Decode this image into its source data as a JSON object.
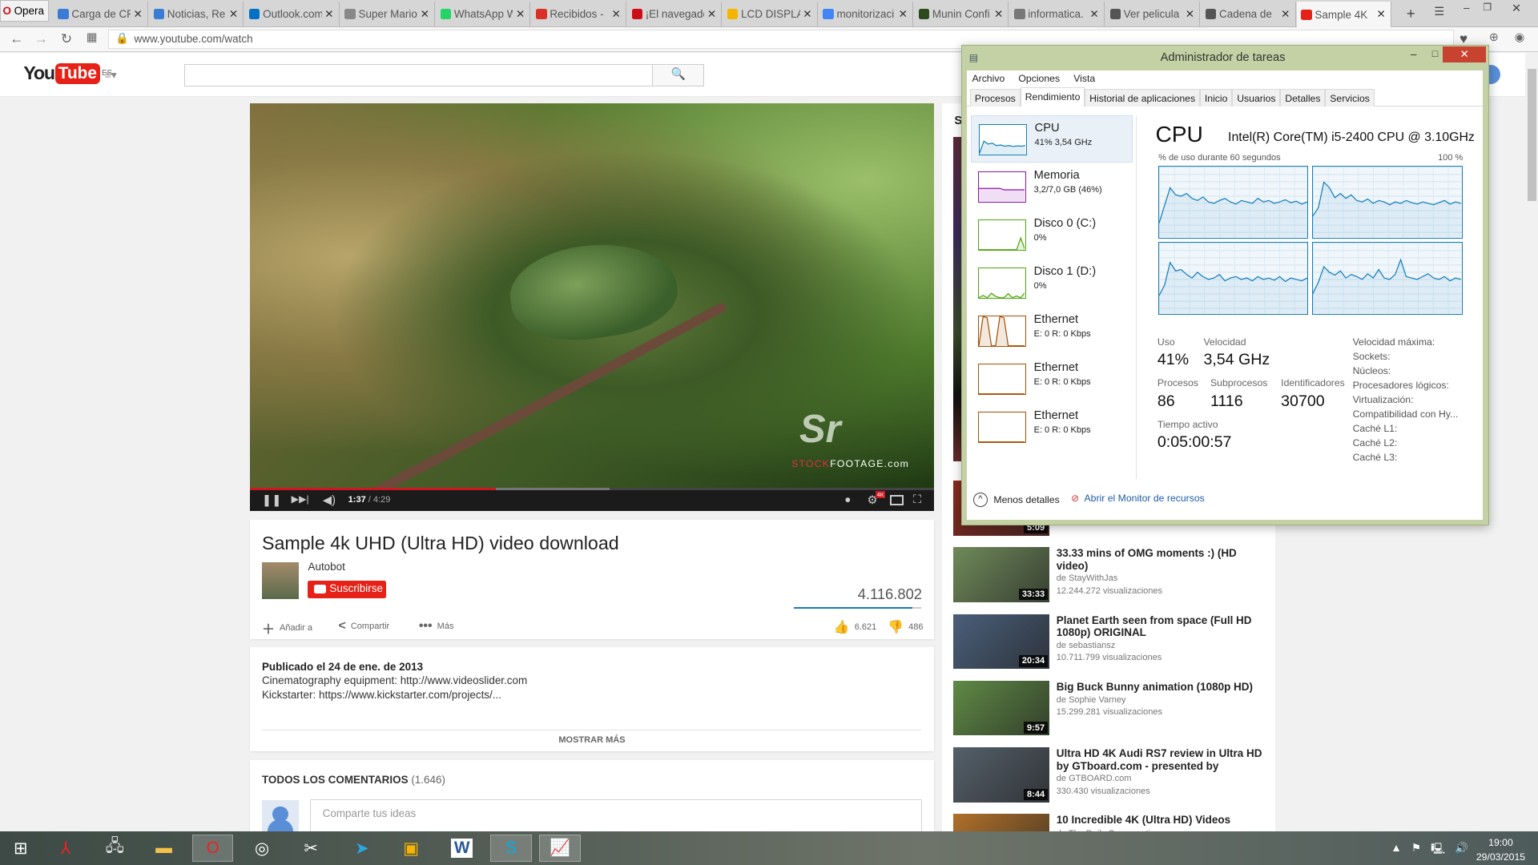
{
  "browser": {
    "name": "Opera",
    "tabs": [
      {
        "title": "Carga de CP",
        "color": "#3a7bd5"
      },
      {
        "title": "Noticias, Re",
        "color": "#3a7bd5"
      },
      {
        "title": "Outlook.com",
        "color": "#0072c6"
      },
      {
        "title": "Super Mario",
        "color": "#888888"
      },
      {
        "title": "WhatsApp W",
        "color": "#25d366"
      },
      {
        "title": "Recibidos -",
        "color": "#d93025"
      },
      {
        "title": "¡El navegado",
        "color": "#cc0f16"
      },
      {
        "title": "LCD DISPLA",
        "color": "#f4b400"
      },
      {
        "title": "monitorizaci",
        "color": "#4285f4"
      },
      {
        "title": "Munin Confi",
        "color": "#2d4a1e"
      },
      {
        "title": "informatica.",
        "color": "#777777"
      },
      {
        "title": "Ver pelicula",
        "color": "#555555"
      },
      {
        "title": "Cadena de",
        "color": "#555555"
      },
      {
        "title": "Sample 4K",
        "color": "#e62117"
      }
    ],
    "url": "www.youtube.com/watch"
  },
  "youtube": {
    "logo_you": "You",
    "logo_tube": "Tube",
    "region": "ES",
    "search_placeholder": "",
    "player": {
      "current": "1:37",
      "total": "/ 4:29",
      "played_fraction": 0.36,
      "buffered_fraction": 0.526,
      "quality_badge": "4K",
      "watermark": "Sr",
      "watermark_sub_red": "STOCK",
      "watermark_sub": "FOOTAGE.com"
    },
    "video": {
      "title": "Sample 4k UHD (Ultra HD) video download",
      "channel": "Autobot",
      "subscribe": "Suscribirse",
      "views": "4.116.802",
      "likes": "6.621",
      "dislikes": "486",
      "like_fraction": 0.93,
      "actions": {
        "add": "Añadir a",
        "share": "Compartir",
        "more": "Más"
      }
    },
    "description": {
      "published": "Publicado el 24 de ene. de 2013",
      "lines": [
        {
          "label": "Cinematography equipment: ",
          "link": "http://www.videoslider.com"
        },
        {
          "label": "Kickstarter: ",
          "link": "https://www.kickstarter.com/projects/..."
        }
      ],
      "show_more": "MOSTRAR MÁS"
    },
    "comments": {
      "heading": "TODOS LOS COMENTARIOS",
      "count": "(1.646)",
      "placeholder": "Comparte tus ideas"
    },
    "sidebar_heading_letter": "S",
    "related": [
      {
        "title": "",
        "channel": "",
        "views": "",
        "duration": "5:09",
        "thumb": "#8a2a20"
      },
      {
        "title": "33.33 mins of OMG moments :) (HD video)",
        "channel": "de StayWithJas",
        "views": "12.244.272 visualizaciones",
        "duration": "33:33",
        "thumb": "#6f8a5a"
      },
      {
        "title": "Planet Earth seen from space (Full HD 1080p) ORIGINAL",
        "channel": "de sebastiansz",
        "views": "10.711.799 visualizaciones",
        "duration": "20:34",
        "thumb": "#4a5f7a"
      },
      {
        "title": "Big Buck Bunny animation (1080p HD)",
        "channel": "de Sophie Varney",
        "views": "15.299.281 visualizaciones",
        "duration": "9:57",
        "thumb": "#5f8a45"
      },
      {
        "title": "Ultra HD 4K Audi RS7 review in Ultra HD by GTboard.com - presented by",
        "channel": "de GTBOARD.com",
        "views": "330.430 visualizaciones",
        "duration": "8:44",
        "thumb": "#55606a"
      },
      {
        "title": "10 Incredible 4K (Ultra HD) Videos",
        "channel": "de The Daily Conversation",
        "views": "",
        "duration": "",
        "thumb": "#b0702a"
      }
    ]
  },
  "task_manager": {
    "title": "Administrador de tareas",
    "menu": [
      "Archivo",
      "Opciones",
      "Vista"
    ],
    "tabs": [
      "Procesos",
      "Rendimiento",
      "Historial de aplicaciones",
      "Inicio",
      "Usuarios",
      "Detalles",
      "Servicios"
    ],
    "active_tab": "Rendimiento",
    "resources": [
      {
        "name": "CPU",
        "sub": "41% 3,54 GHz",
        "color": "#117dbb"
      },
      {
        "name": "Memoria",
        "sub": "3,2/7,0 GB (46%)",
        "color": "#8b12ae"
      },
      {
        "name": "Disco 0 (C:)",
        "sub": "0%",
        "color": "#4da60c"
      },
      {
        "name": "Disco 1 (D:)",
        "sub": "0%",
        "color": "#4da60c"
      },
      {
        "name": "Ethernet",
        "sub": "E: 0 R: 0 Kbps",
        "color": "#a74f01"
      },
      {
        "name": "Ethernet",
        "sub": "E: 0 R: 0 Kbps",
        "color": "#a74f01"
      },
      {
        "name": "Ethernet",
        "sub": "E: 0 R: 0 Kbps",
        "color": "#a74f01"
      }
    ],
    "cpu": {
      "heading": "CPU",
      "model": "Intel(R) Core(TM) i5-2400 CPU @ 3.10GHz",
      "graph_label": "% de uso durante 60 segundos",
      "graph_max": "100 %",
      "core_history": [
        [
          20,
          45,
          70,
          60,
          58,
          62,
          55,
          52,
          57,
          50,
          48,
          52,
          55,
          50,
          47,
          52,
          50,
          48,
          55,
          50,
          52,
          48,
          50,
          53,
          49,
          51,
          47,
          50
        ],
        [
          30,
          42,
          78,
          70,
          56,
          62,
          55,
          60,
          52,
          50,
          54,
          48,
          52,
          50,
          46,
          50,
          48,
          52,
          49,
          47,
          50,
          48,
          46,
          49,
          52,
          47,
          50,
          48
        ],
        [
          25,
          40,
          72,
          60,
          62,
          55,
          50,
          58,
          52,
          48,
          50,
          55,
          46,
          50,
          52,
          48,
          50,
          46,
          52,
          48,
          50,
          47,
          52,
          45,
          50,
          48,
          46,
          50
        ],
        [
          28,
          44,
          66,
          58,
          54,
          60,
          50,
          55,
          52,
          48,
          56,
          50,
          62,
          50,
          48,
          55,
          76,
          52,
          50,
          48,
          52,
          56,
          50,
          48,
          52,
          46,
          50,
          48
        ]
      ],
      "stats": [
        {
          "label": "Uso",
          "value": "41%"
        },
        {
          "label": "Velocidad",
          "value": "3,54 GHz"
        },
        {
          "label": "Procesos",
          "value": "86"
        },
        {
          "label": "Subprocesos",
          "value": "1116"
        },
        {
          "label": "Identificadores",
          "value": "30700"
        },
        {
          "label": "Tiempo activo",
          "value": "0:05:00:57"
        }
      ],
      "right_labels": [
        "Velocidad máxima:",
        "Sockets:",
        "Núcleos:",
        "Procesadores lógicos:",
        "Virtualización:",
        "Compatibilidad con Hy...",
        "Caché L1:",
        "Caché L2:",
        "Caché L3:"
      ]
    },
    "footer": {
      "less_details": "Menos detalles",
      "open_monitor": "Abrir el Monitor de recursos"
    }
  },
  "taskbar": {
    "clock_time": "19:00",
    "clock_date": "29/03/2015"
  }
}
